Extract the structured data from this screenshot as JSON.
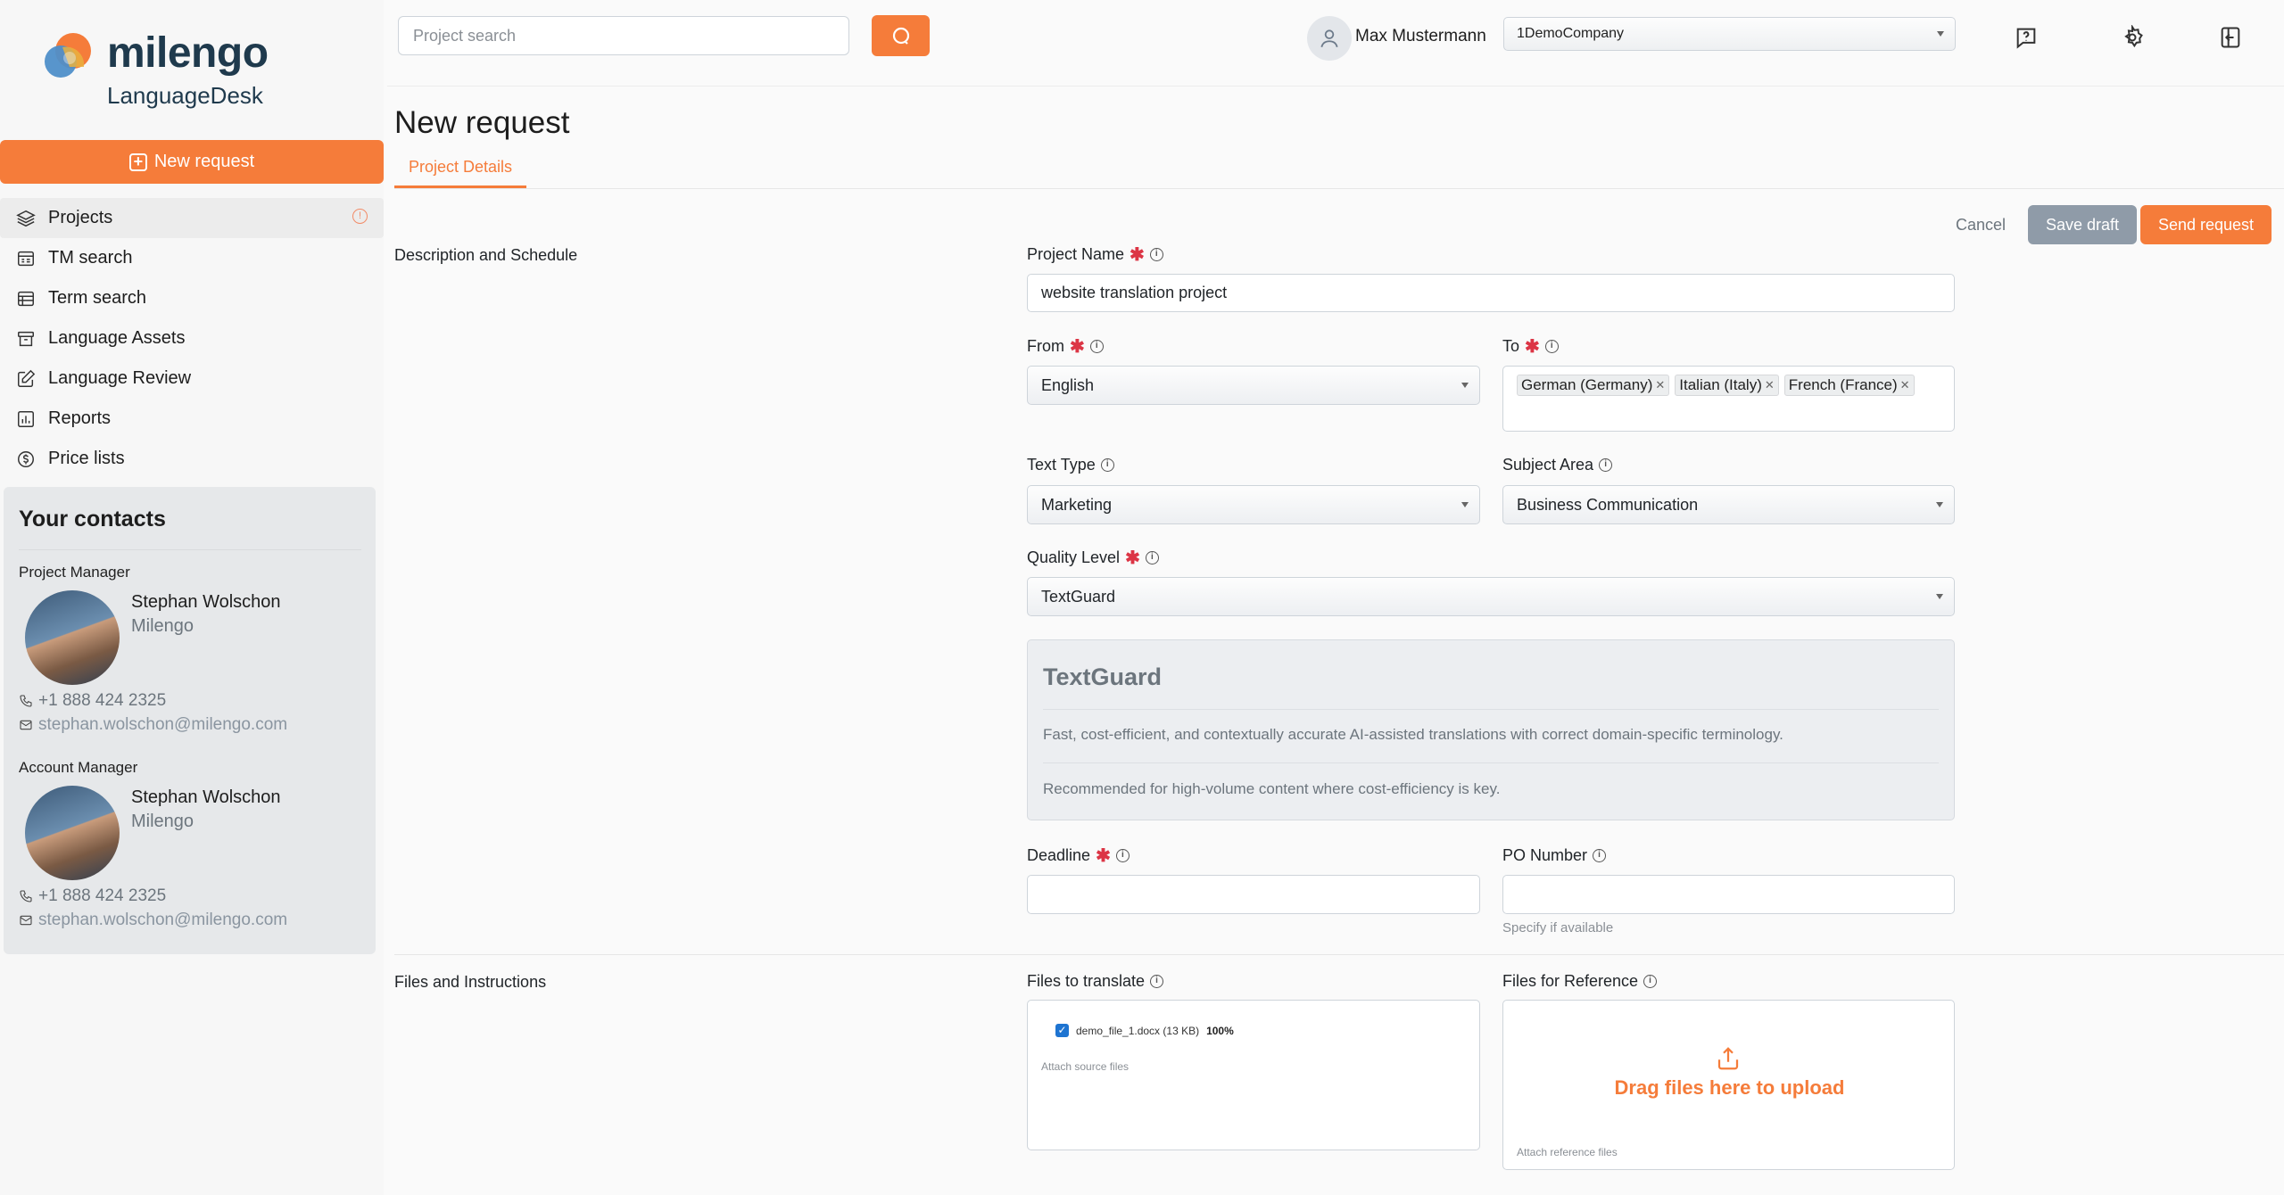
{
  "brand": {
    "name": "milengo",
    "product": "LanguageDesk"
  },
  "sidebar": {
    "new_request": "New request",
    "nav": [
      {
        "label": "Projects",
        "icon": "layers-icon"
      },
      {
        "label": "TM search",
        "icon": "tm-search-icon"
      },
      {
        "label": "Term search",
        "icon": "term-search-icon"
      },
      {
        "label": "Language Assets",
        "icon": "archive-icon"
      },
      {
        "label": "Language Review",
        "icon": "edit-icon"
      },
      {
        "label": "Reports",
        "icon": "reports-icon"
      },
      {
        "label": "Price lists",
        "icon": "price-icon"
      }
    ],
    "contacts": {
      "title": "Your contacts",
      "people": [
        {
          "role": "Project Manager",
          "name": "Stephan Wolschon",
          "company": "Milengo",
          "phone": "+1 888 424 2325",
          "email": "stephan.wolschon@milengo.com"
        },
        {
          "role": "Account Manager",
          "name": "Stephan Wolschon",
          "company": "Milengo",
          "phone": "+1 888 424 2325",
          "email": "stephan.wolschon@milengo.com"
        }
      ]
    }
  },
  "topbar": {
    "search_placeholder": "Project search",
    "user_name": "Max Mustermann",
    "company": "1DemoCompany"
  },
  "page": {
    "title": "New request",
    "tab": "Project Details",
    "actions": {
      "cancel": "Cancel",
      "save_draft": "Save draft",
      "send": "Send request"
    }
  },
  "form": {
    "section_schedule": "Description and Schedule",
    "project_name": {
      "label": "Project Name",
      "value": "website translation project"
    },
    "from": {
      "label": "From",
      "value": "English"
    },
    "to": {
      "label": "To",
      "tags": [
        "German (Germany)",
        "Italian (Italy)",
        "French (France)"
      ]
    },
    "text_type": {
      "label": "Text Type",
      "value": "Marketing"
    },
    "subject_area": {
      "label": "Subject Area",
      "value": "Business Communication"
    },
    "quality_level": {
      "label": "Quality Level",
      "value": "TextGuard"
    },
    "quality_info": {
      "title": "TextGuard",
      "line1": "Fast, cost-efficient, and contextually accurate AI-assisted translations with correct domain-specific terminology.",
      "line2": "Recommended for high-volume content where cost-efficiency is key."
    },
    "deadline": {
      "label": "Deadline",
      "value": ""
    },
    "po_number": {
      "label": "PO Number",
      "value": "",
      "help": "Specify if available"
    },
    "section_files": "Files and Instructions",
    "files_translate": {
      "label": "Files to translate",
      "file": "demo_file_1.docx (13 KB)",
      "progress": "100%",
      "hint": "Attach source files"
    },
    "files_reference": {
      "label": "Files for Reference",
      "drop_text": "Drag files here to upload",
      "hint": "Attach reference files"
    }
  },
  "colors": {
    "accent": "#f57c3a",
    "muted_button": "#8f9ba8",
    "required": "#dc3545"
  }
}
